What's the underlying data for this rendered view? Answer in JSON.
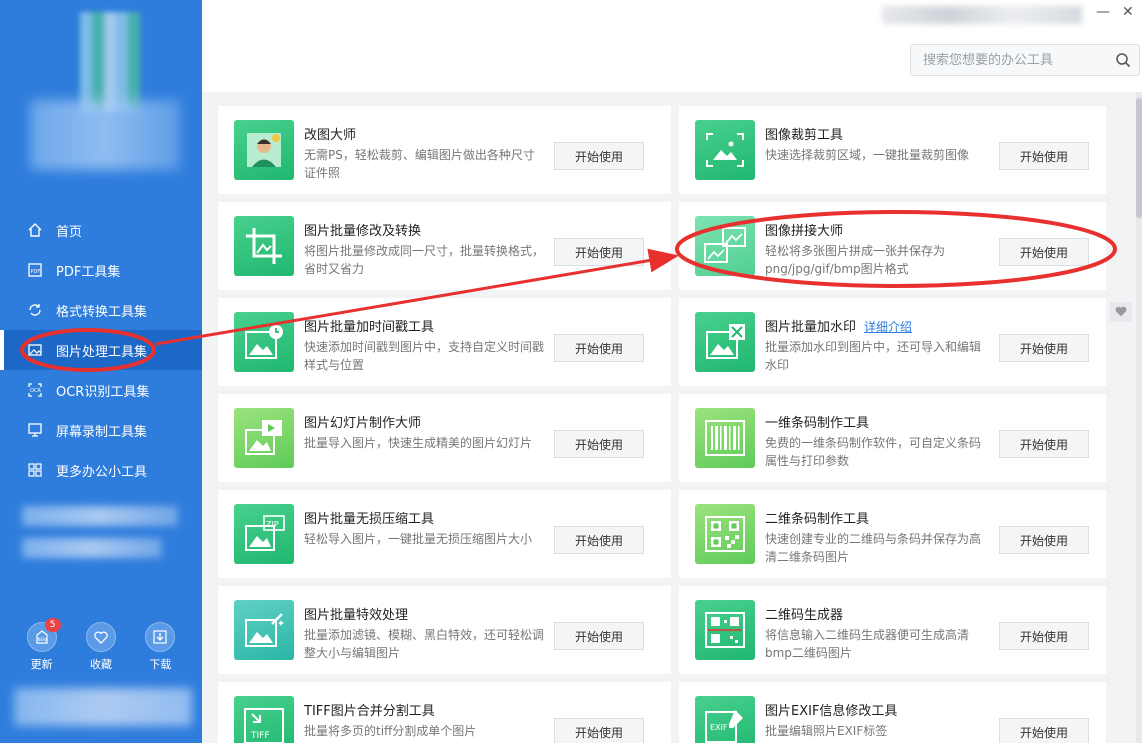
{
  "sidebar": {
    "nav": [
      {
        "label": "首页",
        "icon": "home-icon"
      },
      {
        "label": "PDF工具集",
        "icon": "pdf-icon"
      },
      {
        "label": "格式转换工具集",
        "icon": "convert-icon"
      },
      {
        "label": "图片处理工具集",
        "icon": "image-icon",
        "active": true
      },
      {
        "label": "OCR识别工具集",
        "icon": "ocr-icon"
      },
      {
        "label": "屏幕录制工具集",
        "icon": "screen-record-icon"
      },
      {
        "label": "更多办公小工具",
        "icon": "grid-icon"
      }
    ],
    "bottom": [
      {
        "label": "更新",
        "badge": "5",
        "icon": "update-icon"
      },
      {
        "label": "收藏",
        "icon": "heart-icon"
      },
      {
        "label": "下载",
        "icon": "download-icon"
      }
    ]
  },
  "search": {
    "placeholder": "搜索您想要的办公工具"
  },
  "tools": [
    {
      "name": "改图大师",
      "desc": "无需PS，轻松裁剪、编辑图片做出各种尺寸证件照",
      "btn": "开始使用",
      "icon": "portrait-icon"
    },
    {
      "name": "图像裁剪工具",
      "desc": "快速选择裁剪区域，一键批量裁剪图像",
      "btn": "开始使用",
      "icon": "crop-area-icon"
    },
    {
      "name": "图片批量修改及转换",
      "desc": "将图片批量修改成同一尺寸，批量转换格式，省时又省力",
      "btn": "开始使用",
      "icon": "crop-icon"
    },
    {
      "name": "图像拼接大师",
      "desc": "轻松将多张图片拼成一张并保存为png/jpg/gif/bmp图片格式",
      "btn": "开始使用",
      "icon": "stitch-icon"
    },
    {
      "name": "图片批量加时间戳工具",
      "desc": "快速添加时间戳到图片中，支持自定义时间戳样式与位置",
      "btn": "开始使用",
      "icon": "timestamp-icon"
    },
    {
      "name": "图片批量加水印",
      "link": "详细介绍",
      "desc": "批量添加水印到图片中，还可导入和编辑水印",
      "btn": "开始使用",
      "icon": "watermark-icon"
    },
    {
      "name": "图片幻灯片制作大师",
      "desc": "批量导入图片，快速生成精美的图片幻灯片",
      "btn": "开始使用",
      "icon": "slideshow-icon"
    },
    {
      "name": "一维条码制作工具",
      "desc": "免费的一维条码制作软件，可自定义条码属性与打印参数",
      "btn": "开始使用",
      "icon": "barcode-icon"
    },
    {
      "name": "图片批量无损压缩工具",
      "desc": "轻松导入图片，一键批量无损压缩图片大小",
      "btn": "开始使用",
      "icon": "zip-icon"
    },
    {
      "name": "二维条码制作工具",
      "desc": "快速创建专业的二维码与条码并保存为高清二维条码图片",
      "btn": "开始使用",
      "icon": "qrcode-icon"
    },
    {
      "name": "图片批量特效处理",
      "desc": "批量添加滤镜、模糊、黑白特效，还可轻松调整大小与编辑图片",
      "btn": "开始使用",
      "icon": "effects-icon"
    },
    {
      "name": "二维码生成器",
      "desc": "将信息输入二维码生成器便可生成高清bmp二维码图片",
      "btn": "开始使用",
      "icon": "qr-generator-icon"
    },
    {
      "name": "TIFF图片合并分割工具",
      "desc": "批量将多页的tiff分割成单个图片",
      "btn": "开始使用",
      "icon": "tiff-icon"
    },
    {
      "name": "图片EXIF信息修改工具",
      "desc": "批量编辑照片EXIF标签",
      "btn": "开始使用",
      "icon": "exif-icon"
    }
  ],
  "colors": {
    "sidebar": "#2e7cdc",
    "accent": "#1fb771",
    "annotation": "#e8312f"
  }
}
